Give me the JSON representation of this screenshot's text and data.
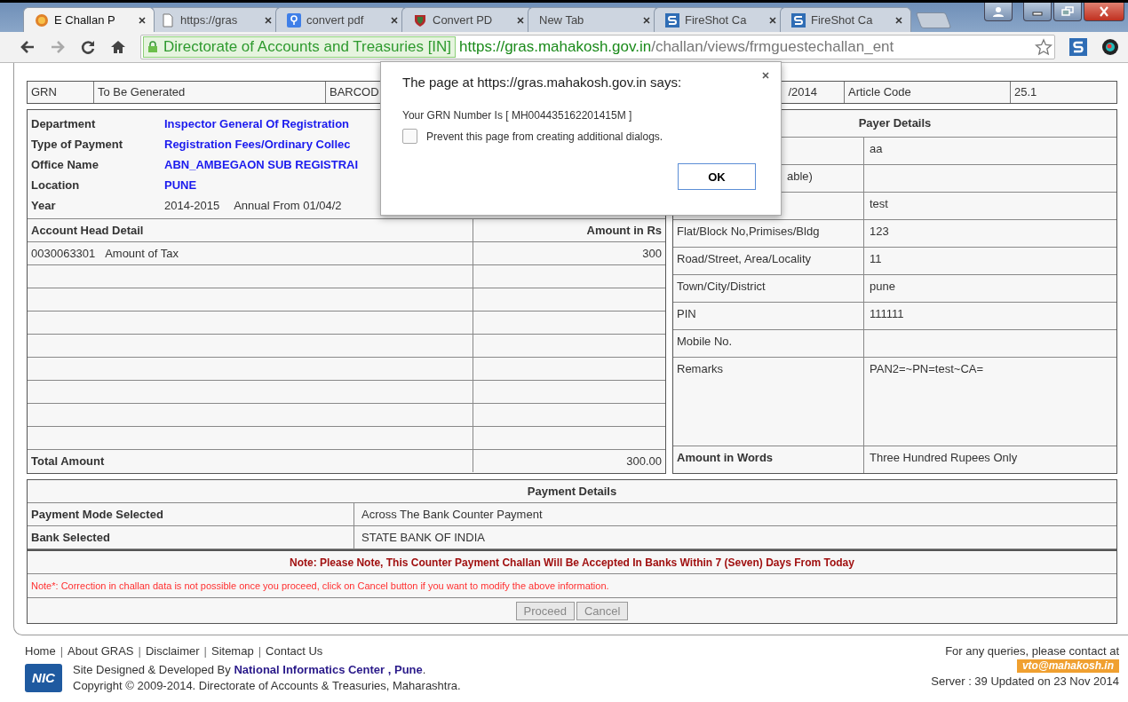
{
  "browser": {
    "tabs": [
      {
        "title": "E Challan P",
        "kind": "coin",
        "selected": true
      },
      {
        "title": "https://gras",
        "kind": "page",
        "selected": false
      },
      {
        "title": "convert pdf",
        "kind": "search",
        "selected": false
      },
      {
        "title": "Convert PD",
        "kind": "shield",
        "selected": false
      },
      {
        "title": "New Tab",
        "kind": "blank",
        "selected": false
      },
      {
        "title": "FireShot Ca",
        "kind": "fireshot",
        "selected": false
      },
      {
        "title": "FireShot Ca",
        "kind": "fireshot",
        "selected": false
      }
    ],
    "site_identity": "Directorate of Accounts and Treasuries [IN]",
    "url_host": "https://gras.mahakosh.gov.in",
    "url_path": "/challan/views/frmguestechallan_ent"
  },
  "top_row": [
    "GRN",
    "To Be Generated",
    "BARCOD",
    "/2014",
    "Article Code",
    "25.1"
  ],
  "challan_info": [
    {
      "label": "Department",
      "value": "Inspector General Of Registration",
      "kind": "link"
    },
    {
      "label": "Type of Payment",
      "value": "Registration Fees/Ordinary Collec",
      "kind": "link"
    },
    {
      "label": "Office Name",
      "value": "ABN_AMBEGAON SUB REGISTRAI",
      "kind": "link"
    },
    {
      "label": "Location",
      "value": "PUNE",
      "kind": "link"
    },
    {
      "label": "Year",
      "value": "2014-2015",
      "extra": "Annual From 01/04/2",
      "kind": "plain"
    }
  ],
  "account_head": {
    "title": "Account Head Detail",
    "amount_title": "Amount in Rs",
    "rows": [
      {
        "code": "0030063301",
        "description": "Amount of Tax",
        "amount": "300"
      }
    ],
    "total_label": "Total Amount",
    "total": "300.00"
  },
  "payer": {
    "title": "Payer Details",
    "rows": [
      {
        "value": "aa"
      },
      {
        "label": "able)"
      },
      {
        "value": "test"
      },
      {
        "label": "Flat/Block No,Primises/Bldg",
        "value": "123"
      },
      {
        "label": "Road/Street, Area/Locality",
        "value": "11"
      },
      {
        "label": "Town/City/District",
        "value": "pune"
      },
      {
        "label": "PIN",
        "value": "111111"
      },
      {
        "label": "Mobile No."
      },
      {
        "label": "Remarks",
        "value": "PAN2=~PN=test~CA=",
        "kind": "tall"
      },
      {
        "label": "Amount in Words",
        "value": "Three Hundred Rupees Only",
        "kind": "bold"
      }
    ]
  },
  "payment": {
    "title": "Payment Details",
    "rows": [
      {
        "label": "Payment Mode Selected",
        "value": "Across The Bank Counter Payment"
      },
      {
        "label": "Bank Selected",
        "value": "STATE BANK OF INDIA"
      }
    ],
    "note": "Note: Please Note, This Counter Payment Challan Will Be Accepted In Banks Within 7 (Seven) Days From Today",
    "warning": "Note*: Correction in challan data is not possible once you proceed, click on Cancel button if you want to modify the above information.",
    "buttons": [
      {
        "label": "Proceed",
        "disabled": true
      },
      {
        "label": "Cancel",
        "disabled": true
      }
    ]
  },
  "footer": {
    "links": [
      {
        "kind": "link",
        "text": "Home"
      },
      {
        "kind": "separator",
        "text": "|"
      },
      {
        "kind": "link",
        "text": "About GRAS"
      },
      {
        "kind": "separator",
        "text": "|"
      },
      {
        "kind": "link",
        "text": "Disclaimer"
      },
      {
        "kind": "separator",
        "text": "|"
      },
      {
        "kind": "link",
        "text": "Sitemap"
      },
      {
        "kind": "separator",
        "text": "|"
      },
      {
        "kind": "link",
        "text": "Contact Us"
      }
    ],
    "logo_text": "NIC",
    "credit": "Site Designed & Developed By **National Informatics Center , Pune**.",
    "copyright": "Copyright © 2009-2014. Directorate of Accounts & Treasuries, Maharashtra.",
    "contact_text": "For any queries, please contact at",
    "email": "vto@mahakosh.in",
    "server": "Server : 39 Updated on 23 Nov 2014"
  },
  "dialog": {
    "title": "The page at https://gras.mahakosh.gov.in says:",
    "message": "Your GRN Number Is [ MH004435162201415M ]",
    "checkbox": {
      "label": "Prevent this page from creating additional dialogs.",
      "checked": false
    },
    "ok": "OK"
  }
}
